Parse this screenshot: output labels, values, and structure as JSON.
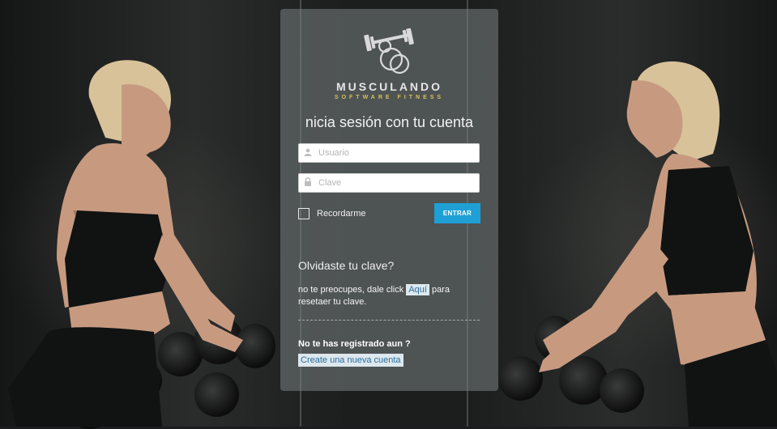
{
  "brand": {
    "name": "MUSCULANDO",
    "tagline": "SOFTWARE FITNESS",
    "logo_icon": "dumbbell-logo-icon"
  },
  "login": {
    "title": "nicia sesión con tu cuenta",
    "username_placeholder": "Usuario",
    "password_placeholder": "Clave",
    "remember_label": "Recordarme",
    "submit_label": "ENTRAR"
  },
  "forgot": {
    "heading": "Olvidaste tu clave?",
    "text_before": "no te preocupes, dale click",
    "link_label": "Aquí",
    "text_after": "para resetaer tu clave."
  },
  "register": {
    "heading": "No te has registrado aun ?",
    "link_label": "Create una nueva cuenta"
  },
  "colors": {
    "accent": "#1ea0d6",
    "tagline": "#d8c25a",
    "panel": "#7a8284"
  },
  "icons": {
    "user": "user-icon",
    "lock": "lock-icon"
  }
}
